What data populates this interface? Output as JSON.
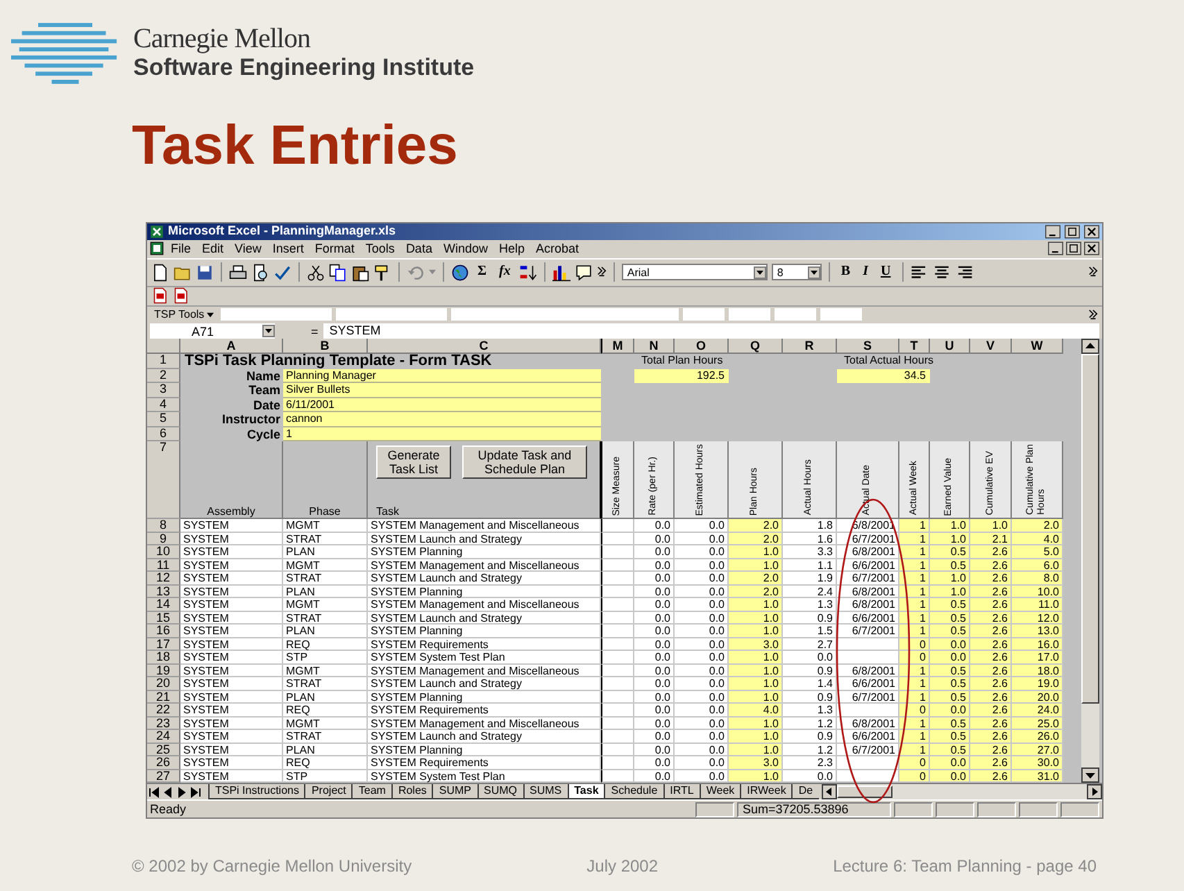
{
  "slide": {
    "org_name": "Carnegie Mellon",
    "org_unit": "Software Engineering Institute",
    "title": "Task Entries"
  },
  "window": {
    "title": "Microsoft Excel - PlanningManager.xls"
  },
  "menu": [
    "File",
    "Edit",
    "View",
    "Insert",
    "Format",
    "Tools",
    "Data",
    "Window",
    "Help",
    "Acrobat"
  ],
  "toolbar": {
    "sum": "Σ",
    "function": "fx",
    "font": "Arial",
    "font_size": "8",
    "bold": "B",
    "italic": "I",
    "underline": "U"
  },
  "tsp_toolbar": {
    "label": "TSP Tools"
  },
  "formula_bar": {
    "name_box": "A71",
    "equals": "=",
    "value": "SYSTEM"
  },
  "columns": [
    "A",
    "B",
    "C",
    "M",
    "N",
    "O",
    "Q",
    "R",
    "S",
    "T",
    "U",
    "V",
    "W"
  ],
  "form": {
    "title_row": "1",
    "title": "TSPi Task Planning Template - Form TASK",
    "fields": [
      {
        "row": "2",
        "label": "Name",
        "value": "Planning Manager"
      },
      {
        "row": "3",
        "label": "Team",
        "value": "Silver Bullets"
      },
      {
        "row": "4",
        "label": "Date",
        "value": "6/11/2001"
      },
      {
        "row": "5",
        "label": "Instructor",
        "value": "cannon"
      },
      {
        "row": "6",
        "label": "Cycle",
        "value": "1"
      }
    ],
    "plan_label": "Total Plan Hours",
    "plan_value": "192.5",
    "actual_label": "Total Actual Hours",
    "actual_value": "34.5",
    "buttons": [
      "Generate Task List",
      "Update Task  and Schedule Plan"
    ]
  },
  "header_row": {
    "row": "7",
    "assembly": "Assembly",
    "phase": "Phase",
    "task": "Task",
    "labels": [
      "Size Measure",
      "Rate (per Hr.)",
      "Estimated Hours",
      "Plan Hours",
      "Actual Hours",
      "Actual Date",
      "Actual Week",
      "Earned Value",
      "Cumulative EV",
      "Cumulative Plan Hours"
    ]
  },
  "rows": [
    {
      "row": "8",
      "assembly": "SYSTEM",
      "phase": "MGMT",
      "task": "SYSTEM Management and Miscellaneous",
      "rate": "0.0",
      "est": "0.0",
      "plan": "2.0",
      "actual": "1.8",
      "date": "6/8/2001",
      "week": "1",
      "ev": "1.0",
      "cum_ev": "1.0",
      "cum_plan": "2.0"
    },
    {
      "row": "9",
      "assembly": "SYSTEM",
      "phase": "STRAT",
      "task": "SYSTEM Launch and Strategy",
      "rate": "0.0",
      "est": "0.0",
      "plan": "2.0",
      "actual": "1.6",
      "date": "6/7/2001",
      "week": "1",
      "ev": "1.0",
      "cum_ev": "2.1",
      "cum_plan": "4.0"
    },
    {
      "row": "10",
      "assembly": "SYSTEM",
      "phase": "PLAN",
      "task": "SYSTEM Planning",
      "rate": "0.0",
      "est": "0.0",
      "plan": "1.0",
      "actual": "3.3",
      "date": "6/8/2001",
      "week": "1",
      "ev": "0.5",
      "cum_ev": "2.6",
      "cum_plan": "5.0"
    },
    {
      "row": "11",
      "assembly": "SYSTEM",
      "phase": "MGMT",
      "task": "SYSTEM Management and Miscellaneous",
      "rate": "0.0",
      "est": "0.0",
      "plan": "1.0",
      "actual": "1.1",
      "date": "6/6/2001",
      "week": "1",
      "ev": "0.5",
      "cum_ev": "2.6",
      "cum_plan": "6.0"
    },
    {
      "row": "12",
      "assembly": "SYSTEM",
      "phase": "STRAT",
      "task": "SYSTEM Launch and Strategy",
      "rate": "0.0",
      "est": "0.0",
      "plan": "2.0",
      "actual": "1.9",
      "date": "6/7/2001",
      "week": "1",
      "ev": "1.0",
      "cum_ev": "2.6",
      "cum_plan": "8.0"
    },
    {
      "row": "13",
      "assembly": "SYSTEM",
      "phase": "PLAN",
      "task": "SYSTEM Planning",
      "rate": "0.0",
      "est": "0.0",
      "plan": "2.0",
      "actual": "2.4",
      "date": "6/8/2001",
      "week": "1",
      "ev": "1.0",
      "cum_ev": "2.6",
      "cum_plan": "10.0"
    },
    {
      "row": "14",
      "assembly": "SYSTEM",
      "phase": "MGMT",
      "task": "SYSTEM Management and Miscellaneous",
      "rate": "0.0",
      "est": "0.0",
      "plan": "1.0",
      "actual": "1.3",
      "date": "6/8/2001",
      "week": "1",
      "ev": "0.5",
      "cum_ev": "2.6",
      "cum_plan": "11.0"
    },
    {
      "row": "15",
      "assembly": "SYSTEM",
      "phase": "STRAT",
      "task": "SYSTEM Launch and Strategy",
      "rate": "0.0",
      "est": "0.0",
      "plan": "1.0",
      "actual": "0.9",
      "date": "6/6/2001",
      "week": "1",
      "ev": "0.5",
      "cum_ev": "2.6",
      "cum_plan": "12.0"
    },
    {
      "row": "16",
      "assembly": "SYSTEM",
      "phase": "PLAN",
      "task": "SYSTEM Planning",
      "rate": "0.0",
      "est": "0.0",
      "plan": "1.0",
      "actual": "1.5",
      "date": "6/7/2001",
      "week": "1",
      "ev": "0.5",
      "cum_ev": "2.6",
      "cum_plan": "13.0"
    },
    {
      "row": "17",
      "assembly": "SYSTEM",
      "phase": "REQ",
      "task": "SYSTEM Requirements",
      "rate": "0.0",
      "est": "0.0",
      "plan": "3.0",
      "actual": "2.7",
      "week": "0",
      "ev": "0.0",
      "cum_ev": "2.6",
      "cum_plan": "16.0"
    },
    {
      "row": "18",
      "assembly": "SYSTEM",
      "phase": "STP",
      "task": "SYSTEM System Test Plan",
      "rate": "0.0",
      "est": "0.0",
      "plan": "1.0",
      "actual": "0.0",
      "week": "0",
      "ev": "0.0",
      "cum_ev": "2.6",
      "cum_plan": "17.0"
    },
    {
      "row": "19",
      "assembly": "SYSTEM",
      "phase": "MGMT",
      "task": "SYSTEM Management and Miscellaneous",
      "rate": "0.0",
      "est": "0.0",
      "plan": "1.0",
      "actual": "0.9",
      "date": "6/8/2001",
      "week": "1",
      "ev": "0.5",
      "cum_ev": "2.6",
      "cum_plan": "18.0"
    },
    {
      "row": "20",
      "assembly": "SYSTEM",
      "phase": "STRAT",
      "task": "SYSTEM Launch and Strategy",
      "rate": "0.0",
      "est": "0.0",
      "plan": "1.0",
      "actual": "1.4",
      "date": "6/6/2001",
      "week": "1",
      "ev": "0.5",
      "cum_ev": "2.6",
      "cum_plan": "19.0"
    },
    {
      "row": "21",
      "assembly": "SYSTEM",
      "phase": "PLAN",
      "task": "SYSTEM Planning",
      "rate": "0.0",
      "est": "0.0",
      "plan": "1.0",
      "actual": "0.9",
      "date": "6/7/2001",
      "week": "1",
      "ev": "0.5",
      "cum_ev": "2.6",
      "cum_plan": "20.0"
    },
    {
      "row": "22",
      "assembly": "SYSTEM",
      "phase": "REQ",
      "task": "SYSTEM Requirements",
      "rate": "0.0",
      "est": "0.0",
      "plan": "4.0",
      "actual": "1.3",
      "week": "0",
      "ev": "0.0",
      "cum_ev": "2.6",
      "cum_plan": "24.0"
    },
    {
      "row": "23",
      "assembly": "SYSTEM",
      "phase": "MGMT",
      "task": "SYSTEM Management and Miscellaneous",
      "rate": "0.0",
      "est": "0.0",
      "plan": "1.0",
      "actual": "1.2",
      "date": "6/8/2001",
      "week": "1",
      "ev": "0.5",
      "cum_ev": "2.6",
      "cum_plan": "25.0"
    },
    {
      "row": "24",
      "assembly": "SYSTEM",
      "phase": "STRAT",
      "task": "SYSTEM Launch and Strategy",
      "rate": "0.0",
      "est": "0.0",
      "plan": "1.0",
      "actual": "0.9",
      "date": "6/6/2001",
      "week": "1",
      "ev": "0.5",
      "cum_ev": "2.6",
      "cum_plan": "26.0"
    },
    {
      "row": "25",
      "assembly": "SYSTEM",
      "phase": "PLAN",
      "task": "SYSTEM Planning",
      "rate": "0.0",
      "est": "0.0",
      "plan": "1.0",
      "actual": "1.2",
      "date": "6/7/2001",
      "week": "1",
      "ev": "0.5",
      "cum_ev": "2.6",
      "cum_plan": "27.0"
    },
    {
      "row": "26",
      "assembly": "SYSTEM",
      "phase": "REQ",
      "task": "SYSTEM Requirements",
      "rate": "0.0",
      "est": "0.0",
      "plan": "3.0",
      "actual": "2.3",
      "week": "0",
      "ev": "0.0",
      "cum_ev": "2.6",
      "cum_plan": "30.0"
    },
    {
      "row": "27",
      "assembly": "SYSTEM",
      "phase": "STP",
      "task": "SYSTEM System Test Plan",
      "rate": "0.0",
      "est": "0.0",
      "plan": "1.0",
      "actual": "0.0",
      "week": "0",
      "ev": "0.0",
      "cum_ev": "2.6",
      "cum_plan": "31.0"
    }
  ],
  "sheet_tabs": [
    {
      "label": "TSPi Instructions",
      "selected": false
    },
    {
      "label": "Project",
      "selected": false
    },
    {
      "label": "Team",
      "selected": false
    },
    {
      "label": "Roles",
      "selected": false
    },
    {
      "label": "SUMP",
      "selected": false
    },
    {
      "label": "SUMQ",
      "selected": false
    },
    {
      "label": "SUMS",
      "selected": false
    },
    {
      "label": "Task",
      "selected": true
    },
    {
      "label": "Schedule",
      "selected": false
    },
    {
      "label": "IRTL",
      "selected": false
    },
    {
      "label": "Week",
      "selected": false
    },
    {
      "label": "IRWeek",
      "selected": false
    },
    {
      "label": "De",
      "selected": false
    }
  ],
  "status_bar": {
    "status": "Ready",
    "sum": "Sum=37205.53896"
  },
  "footer": {
    "copyright": "© 2002 by Carnegie Mellon University",
    "date": "July 2002",
    "page": "Lecture 6: Team Planning - page 40"
  }
}
